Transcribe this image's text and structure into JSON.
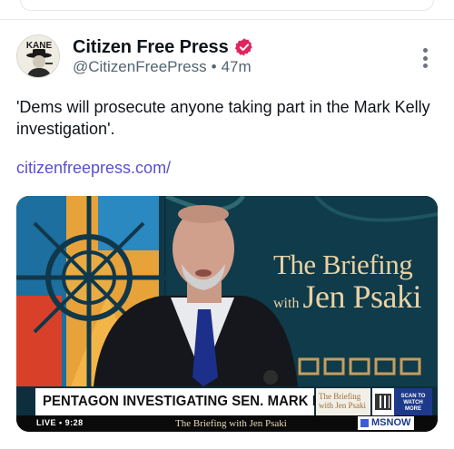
{
  "post": {
    "author_name": "Citizen Free Press",
    "handle": "@CitizenFreePress",
    "separator": "•",
    "time": "47m",
    "text": "'Dems will prosecute anyone taking part in the Mark Kelly investigation'.",
    "link": "citizenfreepress.com/",
    "avatar_text": "KANE"
  },
  "media": {
    "brand_line1": "The Briefing",
    "brand_with": "with",
    "brand_host": "Jen Psaki",
    "chyron": "PENTAGON INVESTIGATING SEN. MARK KELLY",
    "chyron_logo_line1": "The Briefing",
    "chyron_logo_line2": "with Jen Psaki",
    "scan_text": "SCAN TO WATCH MORE",
    "live": "LIVE • 9:28",
    "ticker_show": "The Briefing with Jen Psaki",
    "network": "MSNOW"
  },
  "icons": {
    "verified": "verified-badge-icon",
    "more": "more-vertical-icon"
  },
  "colors": {
    "verified": "#e0245e",
    "link": "#5b4fcf",
    "secondary_text": "#536471"
  }
}
